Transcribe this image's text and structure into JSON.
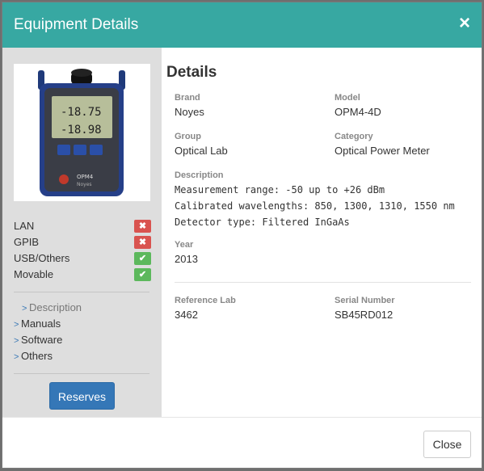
{
  "modal": {
    "title": "Equipment Details",
    "close_icon": "×"
  },
  "sidebar": {
    "features": [
      {
        "label": "LAN",
        "status": "no",
        "icon": "✖"
      },
      {
        "label": "GPIB",
        "status": "no",
        "icon": "✖"
      },
      {
        "label": "USB/Others",
        "status": "yes",
        "icon": "✔"
      },
      {
        "label": "Movable",
        "status": "yes",
        "icon": "✔"
      }
    ],
    "links": [
      {
        "label": "Description",
        "chevron": ">"
      },
      {
        "label": "Manuals",
        "chevron": ">"
      },
      {
        "label": "Software",
        "chevron": ">"
      },
      {
        "label": "Others",
        "chevron": ">"
      }
    ],
    "reserves_label": "Reserves"
  },
  "device": {
    "screen_lines": [
      "-18.75",
      "-18.98"
    ],
    "model_label": "OPM4",
    "brand_label": "Noyes"
  },
  "details": {
    "heading": "Details",
    "brand_label": "Brand",
    "brand_value": "Noyes",
    "model_label": "Model",
    "model_value": "OPM4-4D",
    "group_label": "Group",
    "group_value": "Optical Lab",
    "category_label": "Category",
    "category_value": "Optical Power Meter",
    "description_label": "Description",
    "description_lines": [
      "Measurement range: -50 up to +26 dBm",
      "Calibrated wavelengths: 850, 1300, 1310, 1550 nm",
      "Detector type: Filtered InGaAs"
    ],
    "year_label": "Year",
    "year_value": "2013",
    "reflab_label": "Reference Lab",
    "reflab_value": "3462",
    "serial_label": "Serial Number",
    "serial_value": "SB45RD012"
  },
  "footer": {
    "close_label": "Close"
  },
  "colors": {
    "header": "#37a8a2",
    "primary_button": "#3577b7",
    "badge_no": "#d9534f",
    "badge_yes": "#5cb85c"
  }
}
